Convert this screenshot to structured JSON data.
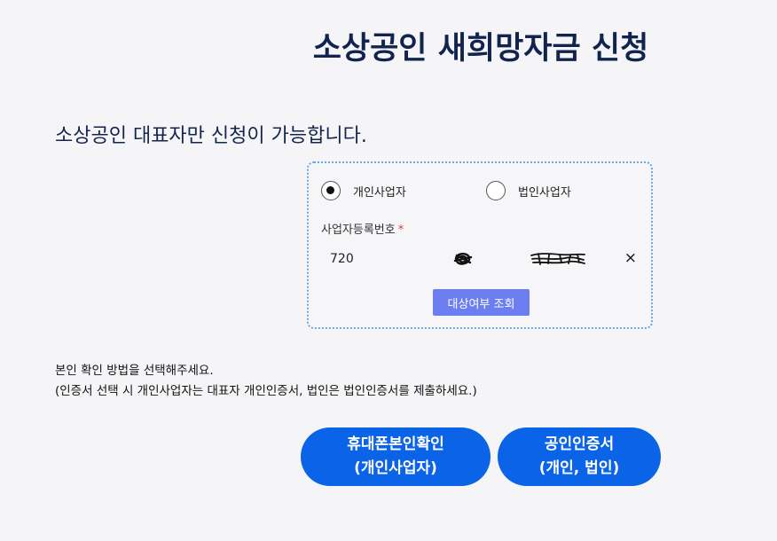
{
  "page": {
    "title": "소상공인 새희망자금 신청",
    "notice": "소상공인 대표자만 신청이 가능합니다."
  },
  "form": {
    "business_types": [
      {
        "label": "개인사업자",
        "selected": true
      },
      {
        "label": "법인사업자",
        "selected": false
      }
    ],
    "brn_label": "사업자등록번호",
    "required_mark": "*",
    "brn_values": [
      "720",
      "",
      ""
    ],
    "clear_label": "×",
    "lookup_button": "대상여부 조회"
  },
  "guide": {
    "line1": "본인 확인 방법을 선택해주세요.",
    "line2": "(인증서 선택 시 개인사업자는 대표자 개인인증서, 법인은 법인인증서를 제출하세요.)"
  },
  "auth": {
    "phone_line1": "휴대폰본인확인",
    "phone_line2": "(개인사업자)",
    "cert_line1": "공인인증서",
    "cert_line2": "(개인, 법인)"
  },
  "colors": {
    "title": "#11234f",
    "primary": "#0b63e8",
    "lookup": "#6d7ff0",
    "box_border": "#6aa6e6",
    "required": "#e23a3a"
  }
}
